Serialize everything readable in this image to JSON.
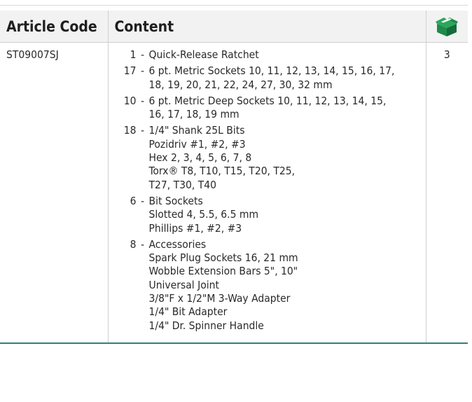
{
  "header": {
    "article_code": "Article Code",
    "content": "Content",
    "quantity_icon": "package-box-icon"
  },
  "colors": {
    "accent": "#2f7f7f",
    "header_bg": "#f2f2f2",
    "icon_green": "#1f8a4c"
  },
  "row": {
    "code": "ST09007SJ",
    "quantity": "3",
    "items": [
      {
        "count": "1",
        "sep": "-",
        "lines": [
          "Quick-Release Ratchet"
        ]
      },
      {
        "count": "17",
        "sep": "-",
        "lines": [
          "6 pt. Metric Sockets 10, 11, 12, 13, 14, 15, 16, 17,",
          "18, 19, 20, 21, 22, 24, 27, 30, 32 mm"
        ]
      },
      {
        "count": "10",
        "sep": "-",
        "lines": [
          "6 pt. Metric Deep Sockets 10, 11, 12, 13, 14, 15,",
          "16, 17, 18, 19 mm"
        ]
      },
      {
        "count": "18",
        "sep": "-",
        "lines": [
          "1/4\" Shank 25L Bits",
          "Pozidriv #1, #2, #3",
          "Hex 2, 3, 4, 5, 6, 7, 8",
          "Torx® T8, T10, T15, T20, T25,",
          "T27, T30, T40"
        ]
      },
      {
        "count": "6",
        "sep": "-",
        "lines": [
          "Bit Sockets",
          "Slotted 4, 5.5, 6.5 mm",
          "Phillips #1, #2, #3"
        ]
      },
      {
        "count": "8",
        "sep": "-",
        "lines": [
          "Accessories",
          "Spark Plug Sockets 16, 21 mm",
          "Wobble Extension Bars 5\", 10\"",
          "Universal Joint",
          "3/8\"F x 1/2\"M 3-Way Adapter",
          "1/4\" Bit Adapter",
          "1/4\" Dr. Spinner Handle"
        ]
      }
    ]
  }
}
